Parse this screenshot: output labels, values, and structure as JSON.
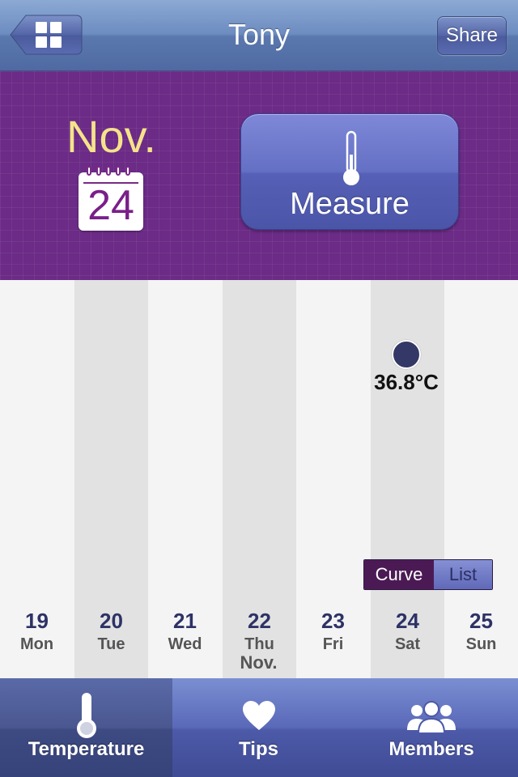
{
  "navbar": {
    "title": "Tony",
    "share_label": "Share",
    "back_icon": "grid-icon"
  },
  "header": {
    "month": "Nov.",
    "calendar_day": "24",
    "measure_label": "Measure",
    "measure_icon": "thermometer-icon"
  },
  "chart": {
    "point_value": "36.8°C",
    "view_toggle": {
      "curve_label": "Curve",
      "list_label": "List",
      "selected": "Curve"
    },
    "days": [
      {
        "num": "19",
        "wd": "Mon"
      },
      {
        "num": "20",
        "wd": "Tue"
      },
      {
        "num": "21",
        "wd": "Wed"
      },
      {
        "num": "22",
        "wd": "Thu"
      },
      {
        "num": "23",
        "wd": "Fri"
      },
      {
        "num": "24",
        "wd": "Sat"
      },
      {
        "num": "25",
        "wd": "Sun"
      }
    ],
    "month_label": "Nov."
  },
  "tabbar": {
    "tabs": [
      {
        "label": "Temperature",
        "icon": "thermometer-icon",
        "active": true
      },
      {
        "label": "Tips",
        "icon": "heart-icon",
        "active": false
      },
      {
        "label": "Members",
        "icon": "people-icon",
        "active": false
      }
    ]
  },
  "colors": {
    "header_purple": "#6b2b86",
    "month_yellow": "#f4e38a",
    "point_navy": "#343866",
    "tab_blue": "#5a68b8"
  }
}
